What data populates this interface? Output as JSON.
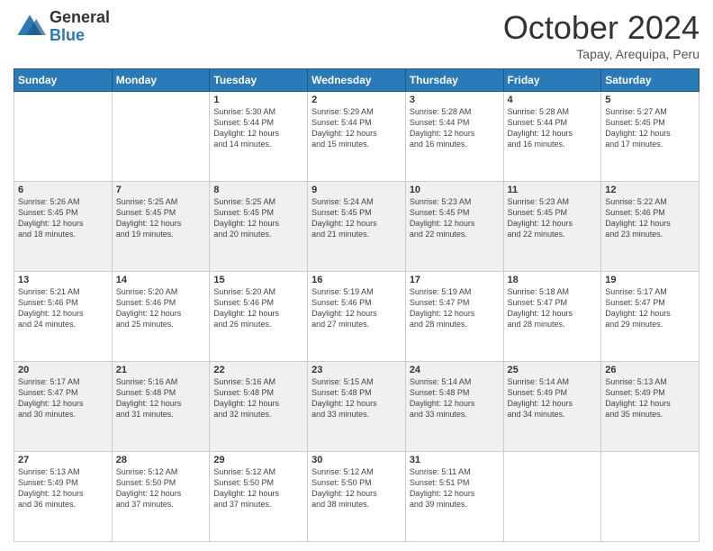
{
  "logo": {
    "general": "General",
    "blue": "Blue"
  },
  "title": "October 2024",
  "subtitle": "Tapay, Arequipa, Peru",
  "days_of_week": [
    "Sunday",
    "Monday",
    "Tuesday",
    "Wednesday",
    "Thursday",
    "Friday",
    "Saturday"
  ],
  "weeks": [
    [
      {
        "day": "",
        "empty": true
      },
      {
        "day": "",
        "empty": true
      },
      {
        "day": "1",
        "sunrise": "5:30 AM",
        "sunset": "5:44 PM",
        "daylight": "12 hours and 14 minutes."
      },
      {
        "day": "2",
        "sunrise": "5:29 AM",
        "sunset": "5:44 PM",
        "daylight": "12 hours and 15 minutes."
      },
      {
        "day": "3",
        "sunrise": "5:28 AM",
        "sunset": "5:44 PM",
        "daylight": "12 hours and 16 minutes."
      },
      {
        "day": "4",
        "sunrise": "5:28 AM",
        "sunset": "5:44 PM",
        "daylight": "12 hours and 16 minutes."
      },
      {
        "day": "5",
        "sunrise": "5:27 AM",
        "sunset": "5:45 PM",
        "daylight": "12 hours and 17 minutes."
      }
    ],
    [
      {
        "day": "6",
        "sunrise": "5:26 AM",
        "sunset": "5:45 PM",
        "daylight": "12 hours and 18 minutes."
      },
      {
        "day": "7",
        "sunrise": "5:25 AM",
        "sunset": "5:45 PM",
        "daylight": "12 hours and 19 minutes."
      },
      {
        "day": "8",
        "sunrise": "5:25 AM",
        "sunset": "5:45 PM",
        "daylight": "12 hours and 20 minutes."
      },
      {
        "day": "9",
        "sunrise": "5:24 AM",
        "sunset": "5:45 PM",
        "daylight": "12 hours and 21 minutes."
      },
      {
        "day": "10",
        "sunrise": "5:23 AM",
        "sunset": "5:45 PM",
        "daylight": "12 hours and 22 minutes."
      },
      {
        "day": "11",
        "sunrise": "5:23 AM",
        "sunset": "5:45 PM",
        "daylight": "12 hours and 22 minutes."
      },
      {
        "day": "12",
        "sunrise": "5:22 AM",
        "sunset": "5:46 PM",
        "daylight": "12 hours and 23 minutes."
      }
    ],
    [
      {
        "day": "13",
        "sunrise": "5:21 AM",
        "sunset": "5:46 PM",
        "daylight": "12 hours and 24 minutes."
      },
      {
        "day": "14",
        "sunrise": "5:20 AM",
        "sunset": "5:46 PM",
        "daylight": "12 hours and 25 minutes."
      },
      {
        "day": "15",
        "sunrise": "5:20 AM",
        "sunset": "5:46 PM",
        "daylight": "12 hours and 26 minutes."
      },
      {
        "day": "16",
        "sunrise": "5:19 AM",
        "sunset": "5:46 PM",
        "daylight": "12 hours and 27 minutes."
      },
      {
        "day": "17",
        "sunrise": "5:19 AM",
        "sunset": "5:47 PM",
        "daylight": "12 hours and 28 minutes."
      },
      {
        "day": "18",
        "sunrise": "5:18 AM",
        "sunset": "5:47 PM",
        "daylight": "12 hours and 28 minutes."
      },
      {
        "day": "19",
        "sunrise": "5:17 AM",
        "sunset": "5:47 PM",
        "daylight": "12 hours and 29 minutes."
      }
    ],
    [
      {
        "day": "20",
        "sunrise": "5:17 AM",
        "sunset": "5:47 PM",
        "daylight": "12 hours and 30 minutes."
      },
      {
        "day": "21",
        "sunrise": "5:16 AM",
        "sunset": "5:48 PM",
        "daylight": "12 hours and 31 minutes."
      },
      {
        "day": "22",
        "sunrise": "5:16 AM",
        "sunset": "5:48 PM",
        "daylight": "12 hours and 32 minutes."
      },
      {
        "day": "23",
        "sunrise": "5:15 AM",
        "sunset": "5:48 PM",
        "daylight": "12 hours and 33 minutes."
      },
      {
        "day": "24",
        "sunrise": "5:14 AM",
        "sunset": "5:48 PM",
        "daylight": "12 hours and 33 minutes."
      },
      {
        "day": "25",
        "sunrise": "5:14 AM",
        "sunset": "5:49 PM",
        "daylight": "12 hours and 34 minutes."
      },
      {
        "day": "26",
        "sunrise": "5:13 AM",
        "sunset": "5:49 PM",
        "daylight": "12 hours and 35 minutes."
      }
    ],
    [
      {
        "day": "27",
        "sunrise": "5:13 AM",
        "sunset": "5:49 PM",
        "daylight": "12 hours and 36 minutes."
      },
      {
        "day": "28",
        "sunrise": "5:12 AM",
        "sunset": "5:50 PM",
        "daylight": "12 hours and 37 minutes."
      },
      {
        "day": "29",
        "sunrise": "5:12 AM",
        "sunset": "5:50 PM",
        "daylight": "12 hours and 37 minutes."
      },
      {
        "day": "30",
        "sunrise": "5:12 AM",
        "sunset": "5:50 PM",
        "daylight": "12 hours and 38 minutes."
      },
      {
        "day": "31",
        "sunrise": "5:11 AM",
        "sunset": "5:51 PM",
        "daylight": "12 hours and 39 minutes."
      },
      {
        "day": "",
        "empty": true
      },
      {
        "day": "",
        "empty": true
      }
    ]
  ],
  "labels": {
    "sunrise": "Sunrise:",
    "sunset": "Sunset:",
    "daylight": "Daylight:"
  }
}
